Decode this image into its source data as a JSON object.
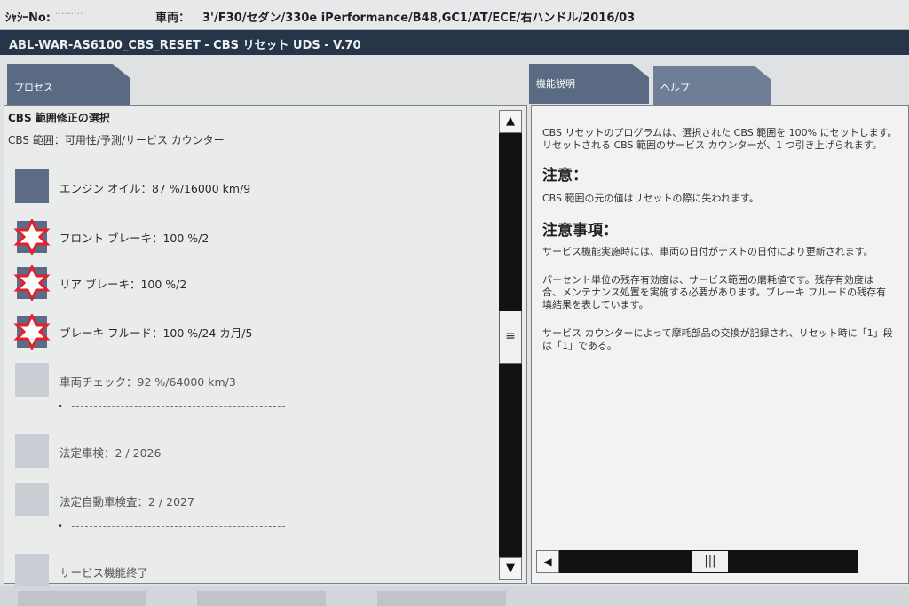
{
  "header": {
    "chassis_label": "ｼｬｼｰNo:",
    "chassis_value": "·········",
    "vehicle_label": "車両：",
    "vehicle_value": "3'/F30/セダン/330e iPerformance/B48,GC1/AT/ECE/右ハンドル/2016/03"
  },
  "window_title": "ABL-WAR-AS6100_CBS_RESET - CBS リセット UDS - V.70",
  "tabs": {
    "process": "プロセス",
    "function_description": "機能説明",
    "help": "ヘルプ"
  },
  "left": {
    "selection_title": "CBS 範囲修正の選択",
    "selection_subtitle": "CBS 範囲：可用性/予測/サービス カウンター",
    "items": [
      {
        "label": "エンジン オイル：87 %/16000 km/9",
        "icon": "blue-square"
      },
      {
        "label": "フロント ブレーキ：100 %/2",
        "icon": "red-star-warning"
      },
      {
        "label": "リア ブレーキ：100 %/2",
        "icon": "red-star-warning"
      },
      {
        "label": "ブレーキ フルード：100 %/24 カ月/5",
        "icon": "red-star-warning"
      },
      {
        "label": "車両チェック：92 %/64000 km/3",
        "icon": "grey-square",
        "sub": "•"
      },
      {
        "label": "法定車検：2 / 2026",
        "icon": "grey-square"
      },
      {
        "label": "法定自動車検査：2 / 2027",
        "icon": "grey-square",
        "sub": "•"
      },
      {
        "label": "サービス機能終了",
        "icon": "grey-square"
      }
    ]
  },
  "right": {
    "intro_line1": "CBS リセットのプログラムは、選択された CBS 範囲を 100% にセットします。",
    "intro_line2": "リセットされる CBS 範囲のサービス カウンターが、1 つ引き上げられます。",
    "heading_caution": "注意：",
    "caution_text": "CBS 範囲の元の値はリセットの際に失われます。",
    "heading_notes": "注意事項：",
    "note1": "サービス機能実施時には、車両の日付がテストの日付により更新されます。",
    "note2_line1": "パーセント単位の残存有効度は、サービス範囲の磨耗値です。残存有効度は",
    "note2_line2": "合、メンテナンス処置を実施する必要があります。ブレーキ フルードの残存有",
    "note2_line3": "填結果を表しています。",
    "note3_line1": "サービス カウンターによって摩耗部品の交換が記録され、リセット時に「1」段",
    "note3_line2": "は「1」である。"
  },
  "colors": {
    "title_bar": "#263547",
    "tab": "#5a6a82",
    "warning_red": "#e0222e",
    "item_square": "#5c6c86"
  }
}
